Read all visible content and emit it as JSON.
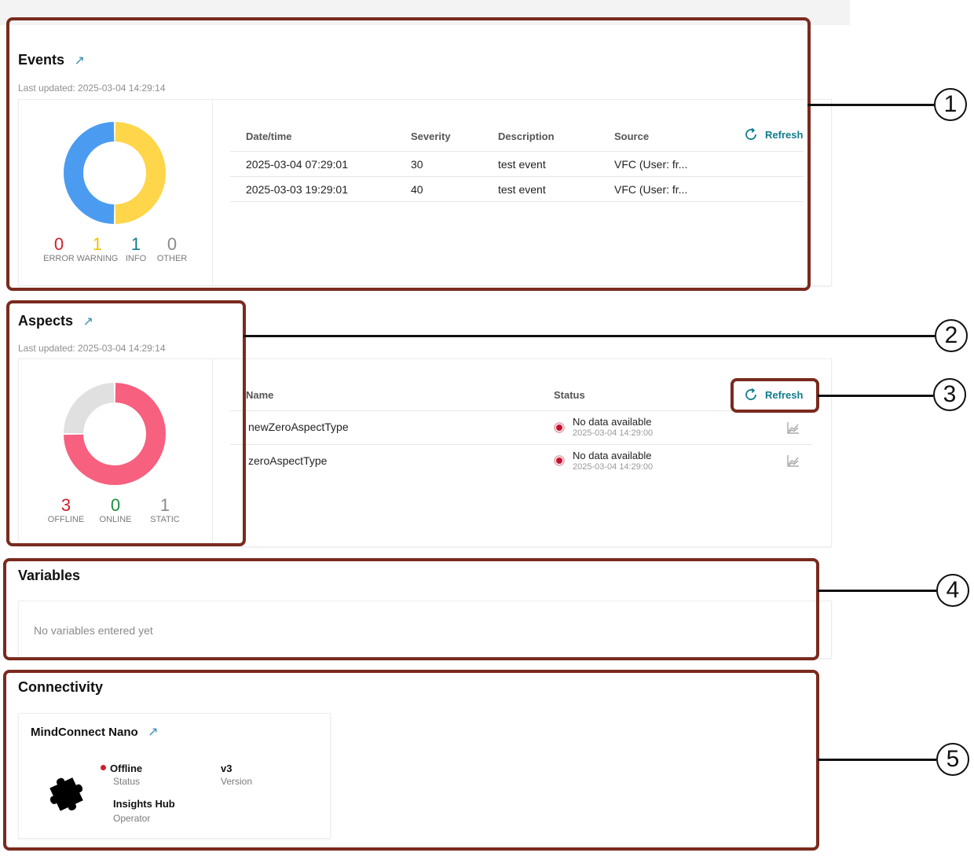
{
  "colors": {
    "error": "#d0202a",
    "warning": "#f0c000",
    "info": "#0f7c8c",
    "other": "#8a8a8a",
    "events_blue": "#4b9cf0",
    "events_yellow": "#ffd54a",
    "aspects_pink": "#f7607f",
    "aspects_grey": "#e0e0e0",
    "online": "#1a8f3a",
    "highlight": "#7a2a1e"
  },
  "events": {
    "title": "Events",
    "last_updated": "Last updated: 2025-03-04 14:29:14",
    "refresh_label": "Refresh",
    "counts": [
      {
        "value": "0",
        "label": "ERROR"
      },
      {
        "value": "1",
        "label": "WARNING"
      },
      {
        "value": "1",
        "label": "INFO"
      },
      {
        "value": "0",
        "label": "OTHER"
      }
    ],
    "columns": [
      "Date/time",
      "Severity",
      "Description",
      "Source"
    ],
    "rows": [
      {
        "datetime": "2025-03-04 07:29:01",
        "severity": "30",
        "description": "test event",
        "source": "VFC (User: fr..."
      },
      {
        "datetime": "2025-03-03 19:29:01",
        "severity": "40",
        "description": "test event",
        "source": "VFC (User: fr..."
      }
    ]
  },
  "aspects": {
    "title": "Aspects",
    "last_updated": "Last updated: 2025-03-04 14:29:14",
    "refresh_label": "Refresh",
    "counts": [
      {
        "value": "3",
        "label": "OFFLINE"
      },
      {
        "value": "0",
        "label": "ONLINE"
      },
      {
        "value": "1",
        "label": "STATIC"
      }
    ],
    "columns": [
      "Name",
      "Status"
    ],
    "rows": [
      {
        "name": "newZeroAspectType",
        "status": "No data available",
        "time": "2025-03-04 14:29:00"
      },
      {
        "name": "zeroAspectType",
        "status": "No data available",
        "time": "2025-03-04 14:29:00"
      }
    ]
  },
  "variables": {
    "title": "Variables",
    "empty_text": "No variables entered yet"
  },
  "connectivity": {
    "title": "Connectivity",
    "device": {
      "name": "MindConnect Nano",
      "status_value": "Offline",
      "status_label": "Status",
      "version_value": "v3",
      "version_label": "Version",
      "operator_value": "Insights Hub",
      "operator_label": "Operator"
    }
  },
  "callouts": [
    "1",
    "2",
    "3",
    "4",
    "5"
  ]
}
